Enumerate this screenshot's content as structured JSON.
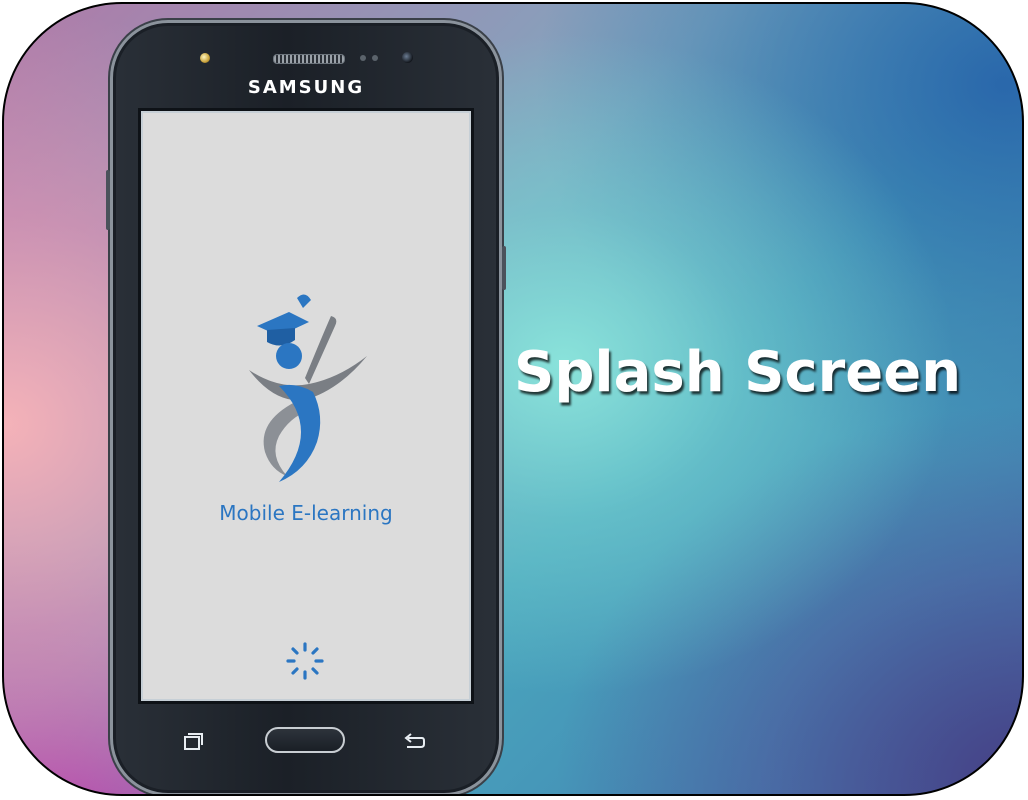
{
  "headline": "Splash Screen",
  "phone": {
    "brand": "SAMSUNG",
    "screen": {
      "app_name": "Mobile E-learning",
      "background": "#dcdcdc",
      "accent": "#2b76c2",
      "logo": "graduate-figure-logo",
      "loading": "spinner-icon"
    },
    "nav_buttons": [
      "recents-icon",
      "home-button",
      "back-icon"
    ]
  },
  "colors": {
    "headline_text": "#ffffff",
    "logo_blue": "#2b76c2",
    "logo_gray": "#7a7e84"
  }
}
